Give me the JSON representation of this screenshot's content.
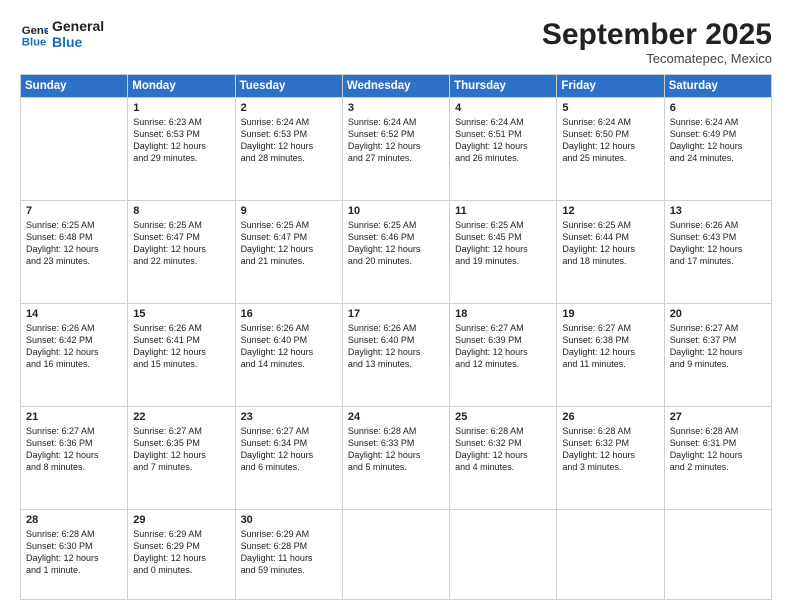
{
  "header": {
    "logo_line1": "General",
    "logo_line2": "Blue",
    "month": "September 2025",
    "location": "Tecomatepec, Mexico"
  },
  "days_of_week": [
    "Sunday",
    "Monday",
    "Tuesday",
    "Wednesday",
    "Thursday",
    "Friday",
    "Saturday"
  ],
  "weeks": [
    [
      {
        "day": "",
        "content": ""
      },
      {
        "day": "1",
        "content": "Sunrise: 6:23 AM\nSunset: 6:53 PM\nDaylight: 12 hours\nand 29 minutes."
      },
      {
        "day": "2",
        "content": "Sunrise: 6:24 AM\nSunset: 6:53 PM\nDaylight: 12 hours\nand 28 minutes."
      },
      {
        "day": "3",
        "content": "Sunrise: 6:24 AM\nSunset: 6:52 PM\nDaylight: 12 hours\nand 27 minutes."
      },
      {
        "day": "4",
        "content": "Sunrise: 6:24 AM\nSunset: 6:51 PM\nDaylight: 12 hours\nand 26 minutes."
      },
      {
        "day": "5",
        "content": "Sunrise: 6:24 AM\nSunset: 6:50 PM\nDaylight: 12 hours\nand 25 minutes."
      },
      {
        "day": "6",
        "content": "Sunrise: 6:24 AM\nSunset: 6:49 PM\nDaylight: 12 hours\nand 24 minutes."
      }
    ],
    [
      {
        "day": "7",
        "content": "Sunrise: 6:25 AM\nSunset: 6:48 PM\nDaylight: 12 hours\nand 23 minutes."
      },
      {
        "day": "8",
        "content": "Sunrise: 6:25 AM\nSunset: 6:47 PM\nDaylight: 12 hours\nand 22 minutes."
      },
      {
        "day": "9",
        "content": "Sunrise: 6:25 AM\nSunset: 6:47 PM\nDaylight: 12 hours\nand 21 minutes."
      },
      {
        "day": "10",
        "content": "Sunrise: 6:25 AM\nSunset: 6:46 PM\nDaylight: 12 hours\nand 20 minutes."
      },
      {
        "day": "11",
        "content": "Sunrise: 6:25 AM\nSunset: 6:45 PM\nDaylight: 12 hours\nand 19 minutes."
      },
      {
        "day": "12",
        "content": "Sunrise: 6:25 AM\nSunset: 6:44 PM\nDaylight: 12 hours\nand 18 minutes."
      },
      {
        "day": "13",
        "content": "Sunrise: 6:26 AM\nSunset: 6:43 PM\nDaylight: 12 hours\nand 17 minutes."
      }
    ],
    [
      {
        "day": "14",
        "content": "Sunrise: 6:26 AM\nSunset: 6:42 PM\nDaylight: 12 hours\nand 16 minutes."
      },
      {
        "day": "15",
        "content": "Sunrise: 6:26 AM\nSunset: 6:41 PM\nDaylight: 12 hours\nand 15 minutes."
      },
      {
        "day": "16",
        "content": "Sunrise: 6:26 AM\nSunset: 6:40 PM\nDaylight: 12 hours\nand 14 minutes."
      },
      {
        "day": "17",
        "content": "Sunrise: 6:26 AM\nSunset: 6:40 PM\nDaylight: 12 hours\nand 13 minutes."
      },
      {
        "day": "18",
        "content": "Sunrise: 6:27 AM\nSunset: 6:39 PM\nDaylight: 12 hours\nand 12 minutes."
      },
      {
        "day": "19",
        "content": "Sunrise: 6:27 AM\nSunset: 6:38 PM\nDaylight: 12 hours\nand 11 minutes."
      },
      {
        "day": "20",
        "content": "Sunrise: 6:27 AM\nSunset: 6:37 PM\nDaylight: 12 hours\nand 9 minutes."
      }
    ],
    [
      {
        "day": "21",
        "content": "Sunrise: 6:27 AM\nSunset: 6:36 PM\nDaylight: 12 hours\nand 8 minutes."
      },
      {
        "day": "22",
        "content": "Sunrise: 6:27 AM\nSunset: 6:35 PM\nDaylight: 12 hours\nand 7 minutes."
      },
      {
        "day": "23",
        "content": "Sunrise: 6:27 AM\nSunset: 6:34 PM\nDaylight: 12 hours\nand 6 minutes."
      },
      {
        "day": "24",
        "content": "Sunrise: 6:28 AM\nSunset: 6:33 PM\nDaylight: 12 hours\nand 5 minutes."
      },
      {
        "day": "25",
        "content": "Sunrise: 6:28 AM\nSunset: 6:32 PM\nDaylight: 12 hours\nand 4 minutes."
      },
      {
        "day": "26",
        "content": "Sunrise: 6:28 AM\nSunset: 6:32 PM\nDaylight: 12 hours\nand 3 minutes."
      },
      {
        "day": "27",
        "content": "Sunrise: 6:28 AM\nSunset: 6:31 PM\nDaylight: 12 hours\nand 2 minutes."
      }
    ],
    [
      {
        "day": "28",
        "content": "Sunrise: 6:28 AM\nSunset: 6:30 PM\nDaylight: 12 hours\nand 1 minute."
      },
      {
        "day": "29",
        "content": "Sunrise: 6:29 AM\nSunset: 6:29 PM\nDaylight: 12 hours\nand 0 minutes."
      },
      {
        "day": "30",
        "content": "Sunrise: 6:29 AM\nSunset: 6:28 PM\nDaylight: 11 hours\nand 59 minutes."
      },
      {
        "day": "",
        "content": ""
      },
      {
        "day": "",
        "content": ""
      },
      {
        "day": "",
        "content": ""
      },
      {
        "day": "",
        "content": ""
      }
    ]
  ]
}
